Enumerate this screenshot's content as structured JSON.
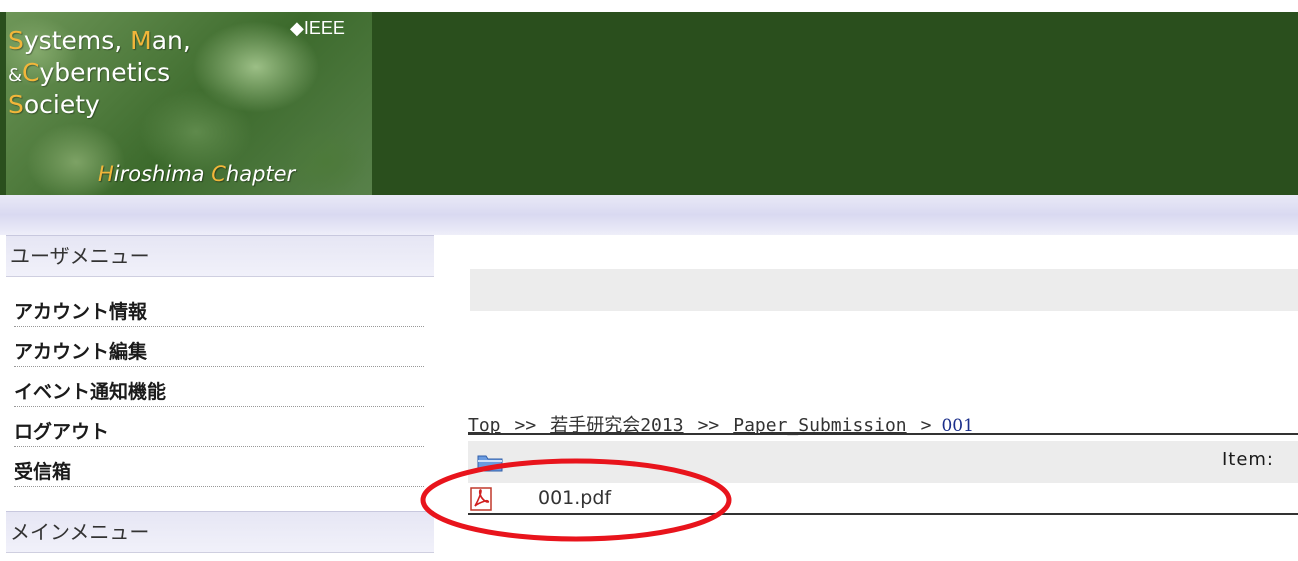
{
  "header": {
    "logo_line1_first": "S",
    "logo_line1_a": "ystems,",
    "logo_line1_m": "M",
    "logo_line1_b": "an,",
    "logo_line2_amp": "&",
    "logo_line2_c": "C",
    "logo_line2_rest": "ybernetics",
    "logo_line3_s": "S",
    "logo_line3_rest": "ociety",
    "ieee": "IEEE",
    "chapter_h": "H",
    "chapter_rest1": "iroshima",
    "chapter_c": "C",
    "chapter_rest2": "hapter"
  },
  "sidebar": {
    "user_menu_title": "ユーザメニュー",
    "items": [
      {
        "label": "アカウント情報"
      },
      {
        "label": "アカウント編集"
      },
      {
        "label": "イベント通知機能"
      },
      {
        "label": "ログアウト"
      },
      {
        "label": "受信箱"
      }
    ],
    "main_menu_title": "メインメニュー"
  },
  "breadcrumb": {
    "items": [
      "Top",
      "若手研究会2013",
      "Paper_Submission"
    ],
    "sep1": ">>",
    "sep2": ">>",
    "sep3": ">",
    "current": "001"
  },
  "list": {
    "item_label": "Item:",
    "file_name": "001.pdf"
  },
  "colors": {
    "header_green": "#2a4f1d",
    "highlight": "#f2b63a",
    "annotation_red": "#e8141c"
  }
}
